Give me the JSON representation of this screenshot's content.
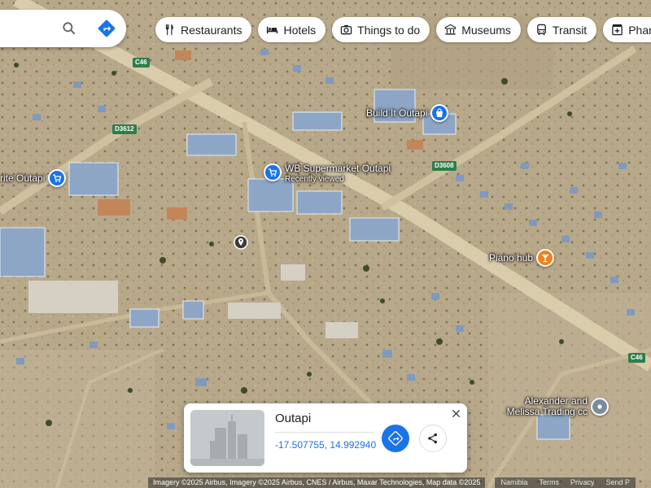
{
  "search": {
    "search_icon": "search-icon",
    "directions_icon": "directions-icon"
  },
  "chips": [
    {
      "label": "Restaurants",
      "icon": "fork-knife-icon"
    },
    {
      "label": "Hotels",
      "icon": "bed-icon"
    },
    {
      "label": "Things to do",
      "icon": "camera-icon"
    },
    {
      "label": "Museums",
      "icon": "museum-icon"
    },
    {
      "label": "Transit",
      "icon": "bus-icon"
    },
    {
      "label": "Pharmac",
      "icon": "pharmacy-icon"
    }
  ],
  "map": {
    "roads": [
      "C46",
      "D3612",
      "D3608",
      "C46"
    ],
    "places": [
      {
        "name": "Build It Outapi",
        "icon": "shopping-bag-icon",
        "color": "#1a73e8"
      },
      {
        "name": "WB Supermarket Outapi",
        "sub": "Recently viewed",
        "icon": "shopping-cart-icon",
        "color": "#1a73e8"
      },
      {
        "name": "rite Outapi",
        "icon": "shopping-cart-icon",
        "color": "#1a73e8"
      },
      {
        "name": "Piano hub",
        "icon": "cocktail-icon",
        "color": "#f4801a"
      },
      {
        "name": "Alexander and Melissa Trading cc",
        "icon": "place-icon",
        "color": "#7a8c9c"
      }
    ]
  },
  "card": {
    "title": "Outapi",
    "coords": "-17.507755, 14.992940",
    "directions_icon": "directions-icon",
    "share_icon": "share-icon",
    "close_icon": "close-icon"
  },
  "footer": {
    "attribution": "Imagery ©2025 Airbus, Imagery ©2025 Airbus, CNES / Airbus, Maxar Technologies, Map data ©2025",
    "region": "Namibia",
    "terms": "Terms",
    "privacy": "Privacy",
    "feedback": "Send P"
  },
  "colors": {
    "accent": "#1a73e8",
    "road_shield": "#2f7d4a",
    "ground": "#b9a98c"
  }
}
